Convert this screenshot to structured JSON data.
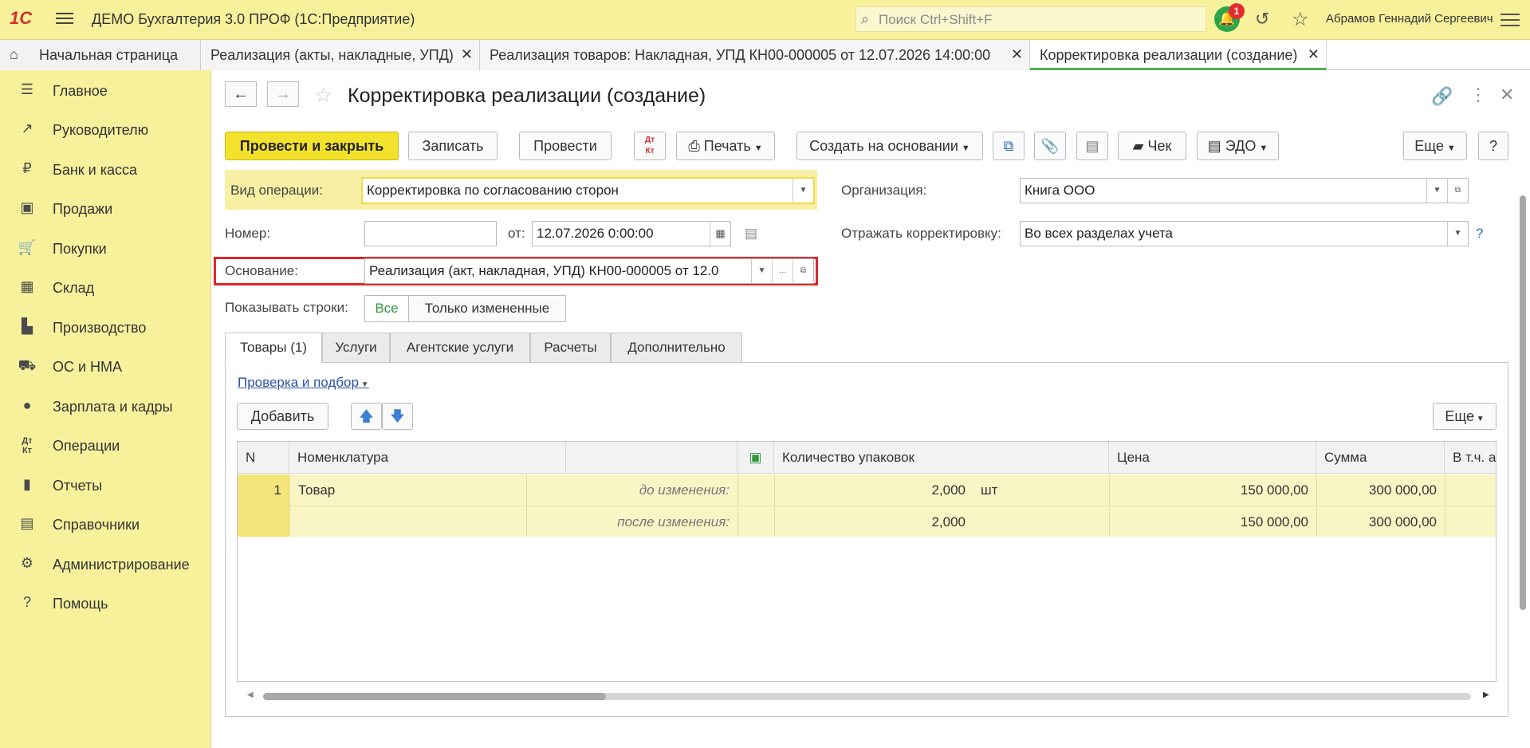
{
  "app": {
    "title": "ДЕМО Бухгалтерия 3.0 ПРОФ  (1С:Предприятие)",
    "search_placeholder": "Поиск Ctrl+Shift+F",
    "notifications": "1",
    "user": "Абрамов Геннадий Сергеевич"
  },
  "tabs": {
    "home": "Начальная страница",
    "items": [
      {
        "label": "Реализация (акты, накладные, УПД)"
      },
      {
        "label": "Реализация товаров: Накладная, УПД КН00-000005 от 12.07.2026 14:00:00"
      },
      {
        "label": "Корректировка реализации (создание)"
      }
    ]
  },
  "sidebar": {
    "items": [
      {
        "label": "Главное",
        "icon": "menu-icon"
      },
      {
        "label": "Руководителю",
        "icon": "trend-icon"
      },
      {
        "label": "Банк и касса",
        "icon": "coin-icon"
      },
      {
        "label": "Продажи",
        "icon": "bag-icon"
      },
      {
        "label": "Покупки",
        "icon": "cart-icon"
      },
      {
        "label": "Склад",
        "icon": "warehouse-icon"
      },
      {
        "label": "Производство",
        "icon": "factory-icon"
      },
      {
        "label": "ОС и НМА",
        "icon": "truck-icon"
      },
      {
        "label": "Зарплата и кадры",
        "icon": "person-icon"
      },
      {
        "label": "Операции",
        "icon": "dt-kt-icon"
      },
      {
        "label": "Отчеты",
        "icon": "bar-chart-icon"
      },
      {
        "label": "Справочники",
        "icon": "books-icon"
      },
      {
        "label": "Администрирование",
        "icon": "gear-icon"
      },
      {
        "label": "Помощь",
        "icon": "question-icon"
      }
    ]
  },
  "form": {
    "title": "Корректировка реализации (создание)",
    "toolbar": {
      "post_close": "Провести и закрыть",
      "save": "Записать",
      "post": "Провести",
      "print": "Печать",
      "create_based": "Создать на основании",
      "check": "Чек",
      "edo": "ЭДО",
      "more": "Еще",
      "help": "?"
    },
    "fields": {
      "op_type_label": "Вид операции:",
      "op_type_value": "Корректировка по согласованию сторон",
      "number_label": "Номер:",
      "number_value": "",
      "from_label": "от:",
      "date_value": "12.07.2026  0:00:00",
      "basis_label": "Основание:",
      "basis_value": "Реализация (акт, накладная, УПД) КН00-000005 от 12.0",
      "show_rows_label": "Показывать строки:",
      "show_all": "Все",
      "show_changed": "Только измененные",
      "org_label": "Организация:",
      "org_value": "Книга ООО",
      "reflect_label": "Отражать корректировку:",
      "reflect_value": "Во всех разделах учета",
      "help_q": "?"
    },
    "tabs": [
      "Товары (1)",
      "Услуги",
      "Агентские услуги",
      "Расчеты",
      "Дополнительно"
    ],
    "goods": {
      "check_link": "Проверка и подбор",
      "add": "Добавить",
      "more": "Еще",
      "columns": {
        "n": "N",
        "nomenclature": "Номенклатура",
        "qty": "Количество упаковок",
        "price": "Цена",
        "sum": "Сумма",
        "vat": "В т.ч. а"
      },
      "rows": [
        {
          "n": "1",
          "name": "Товар",
          "before_label": "до изменения:",
          "after_label": "после изменения:",
          "qty_before": "2,000",
          "unit": "шт",
          "qty_after": "2,000",
          "price_before": "150 000,00",
          "price_after": "150 000,00",
          "sum_before": "300 000,00",
          "sum_after": "300 000,00"
        }
      ]
    }
  },
  "colors": {
    "accent_yellow": "#f7f19c",
    "primary_button": "#f3e22b",
    "highlight_red": "#e1262a",
    "active_tab_green": "#4caf50"
  }
}
